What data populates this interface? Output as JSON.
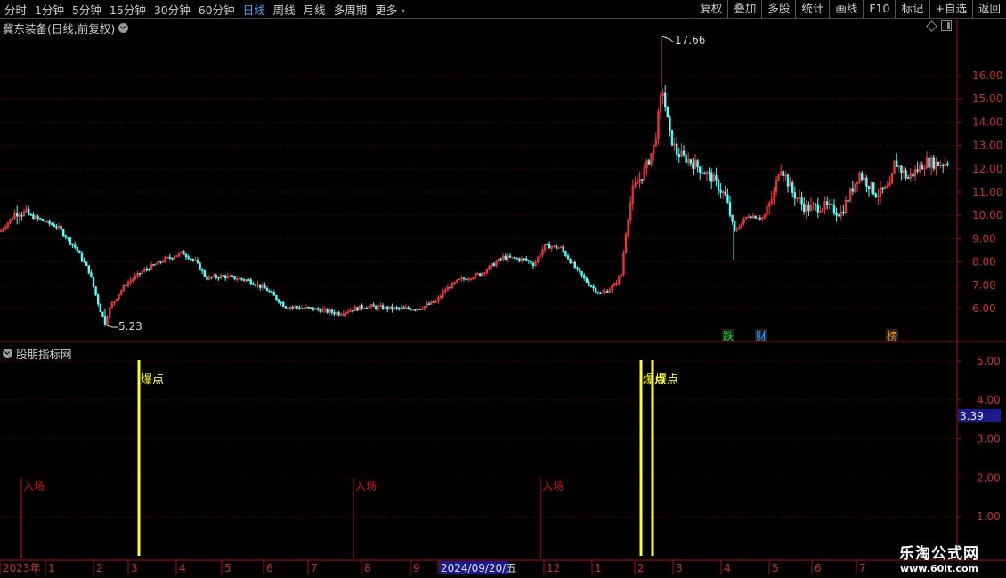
{
  "toolbar": {
    "periods": [
      "分时",
      "1分钟",
      "5分钟",
      "15分钟",
      "30分钟",
      "60分钟",
      "日线",
      "周线",
      "月线",
      "多周期",
      "更多"
    ],
    "active_period": "日线",
    "right_buttons": [
      "复权",
      "叠加",
      "多股",
      "统计",
      "画线",
      "F10",
      "标记",
      "+自选",
      "返回"
    ]
  },
  "main_chart": {
    "title": "冀东装备(日线,前复权)",
    "y_ticks": [
      "16.00",
      "15.00",
      "14.00",
      "13.00",
      "12.00",
      "11.00",
      "10.00",
      "9.00",
      "8.00",
      "7.00",
      "6.00"
    ],
    "high_label": "17.66",
    "low_label": "5.23",
    "event_tags": [
      {
        "text": "跌",
        "color": "#22cc22"
      },
      {
        "text": "财",
        "color": "#3aa0ff"
      },
      {
        "text": "榜",
        "color": "#ff8800"
      }
    ]
  },
  "indicator": {
    "title": "股朋指标网",
    "y_ticks": [
      "5.00",
      "4.00",
      "3.00",
      "2.00",
      "1.00"
    ],
    "current_value": "3.39",
    "explode_label": "爆点",
    "entry_label": "入场"
  },
  "x_axis": {
    "labels": [
      "2023年",
      "1",
      "2",
      "3",
      "4",
      "5",
      "6",
      "7",
      "8",
      "9",
      "2024/09/20/五",
      "12",
      "1",
      "2",
      "3",
      "4",
      "5",
      "6",
      "7"
    ]
  },
  "watermark": {
    "line1": "乐淘公式网",
    "line2": "www.60lt.com"
  },
  "chart_data": {
    "type": "candlestick",
    "title": "冀东装备(日线,前复权)",
    "ylim": [
      5.0,
      17.9
    ],
    "price_path": [
      [
        0,
        9.3
      ],
      [
        20,
        10.2
      ],
      [
        40,
        9.9
      ],
      [
        65,
        9.5
      ],
      [
        85,
        8.6
      ],
      [
        100,
        7.6
      ],
      [
        112,
        6.0
      ],
      [
        118,
        5.4
      ],
      [
        124,
        6.1
      ],
      [
        140,
        7.0
      ],
      [
        160,
        7.6
      ],
      [
        185,
        8.1
      ],
      [
        205,
        8.4
      ],
      [
        220,
        8.0
      ],
      [
        232,
        7.3
      ],
      [
        250,
        7.4
      ],
      [
        280,
        7.2
      ],
      [
        300,
        6.8
      ],
      [
        320,
        6.1
      ],
      [
        350,
        6.0
      ],
      [
        380,
        5.8
      ],
      [
        410,
        6.1
      ],
      [
        440,
        6.0
      ],
      [
        470,
        6.0
      ],
      [
        490,
        6.3
      ],
      [
        500,
        6.8
      ],
      [
        515,
        7.2
      ],
      [
        540,
        7.5
      ],
      [
        565,
        8.2
      ],
      [
        590,
        8.1
      ],
      [
        600,
        7.9
      ],
      [
        612,
        8.7
      ],
      [
        630,
        8.6
      ],
      [
        645,
        7.8
      ],
      [
        660,
        7.1
      ],
      [
        675,
        6.6
      ],
      [
        690,
        7.0
      ],
      [
        698,
        7.5
      ],
      [
        702,
        9.0
      ],
      [
        710,
        11.0
      ],
      [
        725,
        12.0
      ],
      [
        735,
        13.0
      ],
      [
        744,
        15.5
      ],
      [
        752,
        13.5
      ],
      [
        760,
        12.7
      ],
      [
        780,
        12.2
      ],
      [
        800,
        11.6
      ],
      [
        815,
        10.8
      ],
      [
        825,
        9.3
      ],
      [
        840,
        10.0
      ],
      [
        858,
        9.9
      ],
      [
        870,
        11.0
      ],
      [
        876,
        12.2
      ],
      [
        890,
        11.0
      ],
      [
        905,
        10.3
      ],
      [
        925,
        10.4
      ],
      [
        945,
        10.1
      ],
      [
        965,
        11.8
      ],
      [
        985,
        10.9
      ],
      [
        1000,
        11.2
      ],
      [
        1005,
        12.3
      ],
      [
        1020,
        11.6
      ],
      [
        1040,
        12.3
      ],
      [
        1055,
        12.2
      ],
      [
        1067,
        12.3
      ]
    ],
    "indicator": {
      "ylim": [
        0,
        5.5
      ],
      "explode_points": [
        "2023-03",
        "2024-02",
        "2024-02"
      ],
      "entry_points": [
        "2022-12",
        "2023-08",
        "2023-12"
      ],
      "current": 3.39
    }
  }
}
